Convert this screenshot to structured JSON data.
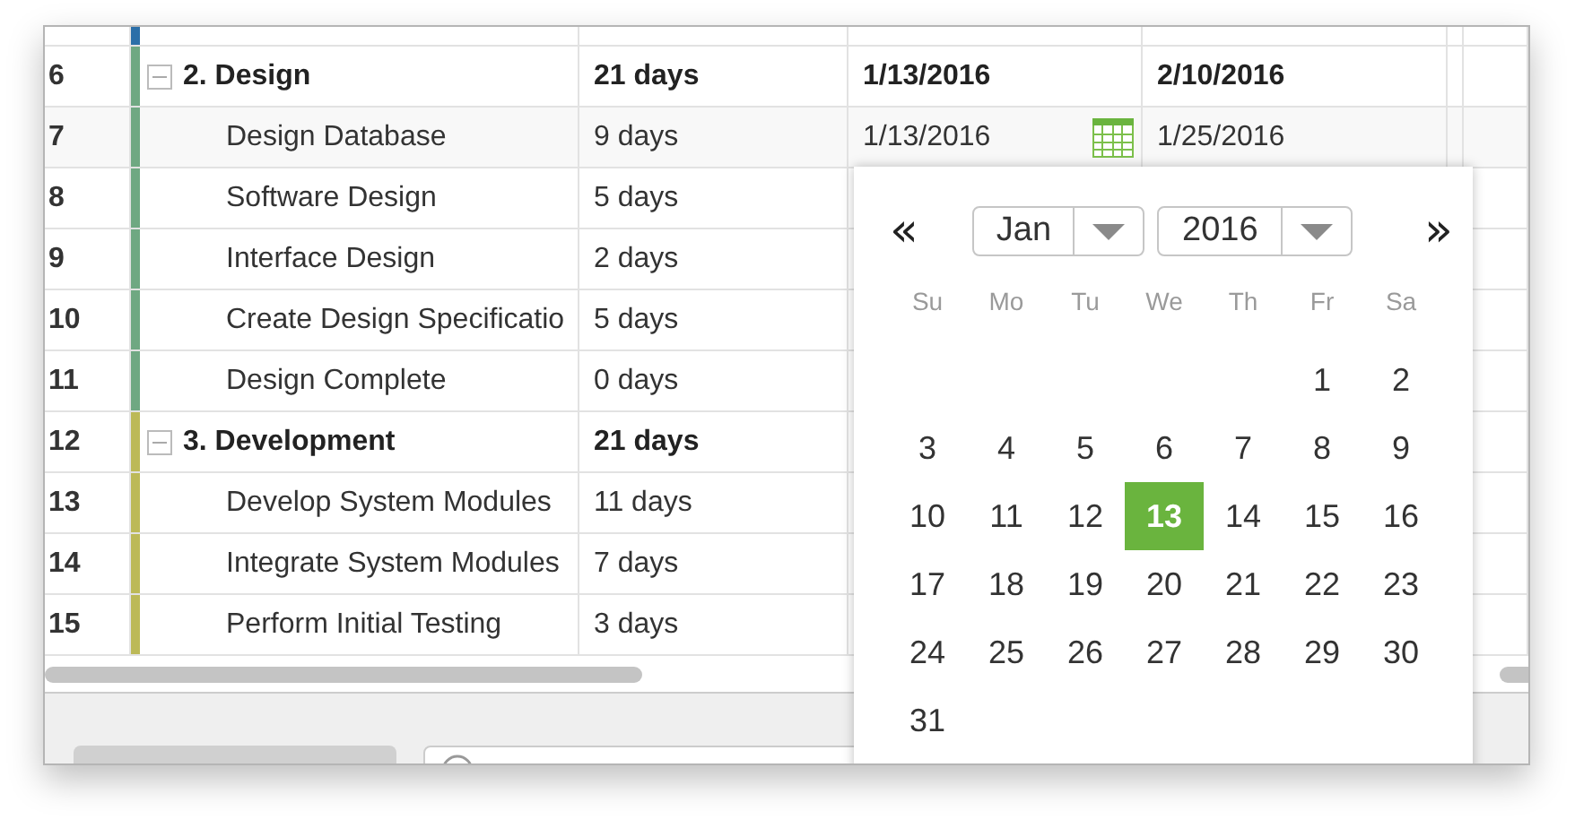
{
  "cut_row": {
    "color": "#2b6fa8"
  },
  "rows": [
    {
      "number": "6",
      "kind": "summary",
      "expanded": true,
      "name": "2. Design",
      "duration": "21 days",
      "start": "1/13/2016",
      "finish": "2/10/2016",
      "editing": false,
      "color": "#6fa882"
    },
    {
      "number": "7",
      "kind": "task",
      "name": "Design Database",
      "duration": "9 days",
      "start": "1/13/2016",
      "finish": "1/25/2016",
      "editing": true,
      "color": "#6fa882"
    },
    {
      "number": "8",
      "kind": "task",
      "name": "Software Design",
      "duration": "5 days",
      "color": "#6fa882"
    },
    {
      "number": "9",
      "kind": "task",
      "name": "Interface Design",
      "duration": "2 days",
      "color": "#6fa882"
    },
    {
      "number": "10",
      "kind": "task",
      "name": "Create Design Specificatio",
      "duration": "5 days",
      "color": "#6fa882"
    },
    {
      "number": "11",
      "kind": "task",
      "name": "Design Complete",
      "duration": "0 days",
      "color": "#6fa882"
    },
    {
      "number": "12",
      "kind": "summary",
      "expanded": true,
      "name": "3. Development",
      "duration": "21 days",
      "color": "#bcb957"
    },
    {
      "number": "13",
      "kind": "task",
      "name": "Develop System Modules",
      "duration": "11 days",
      "color": "#bcb957"
    },
    {
      "number": "14",
      "kind": "task",
      "name": "Integrate System Modules",
      "duration": "7 days",
      "color": "#bcb957"
    },
    {
      "number": "15",
      "kind": "task",
      "name": "Perform Initial Testing",
      "duration": "3 days",
      "color": "#bcb957"
    }
  ],
  "calendar": {
    "prev": "«",
    "next": "»",
    "month": "Jan",
    "year": "2016",
    "weekdays": [
      "Su",
      "Mo",
      "Tu",
      "We",
      "Th",
      "Fr",
      "Sa"
    ],
    "weeks": [
      {
        "days": [
          {
            "day": "1",
            "selected": false
          },
          {
            "day": "2",
            "selected": false
          }
        ]
      },
      {
        "days": [
          {
            "day": "3",
            "selected": false
          },
          {
            "day": "4",
            "selected": false
          },
          {
            "day": "5",
            "selected": false
          },
          {
            "day": "6",
            "selected": false
          },
          {
            "day": "7",
            "selected": false
          },
          {
            "day": "8",
            "selected": false
          },
          {
            "day": "9",
            "selected": false
          }
        ]
      },
      {
        "days": [
          {
            "day": "10",
            "selected": false
          },
          {
            "day": "11",
            "selected": false
          },
          {
            "day": "12",
            "selected": false
          },
          {
            "day": "13",
            "selected": true
          },
          {
            "day": "14",
            "selected": false
          },
          {
            "day": "15",
            "selected": false
          },
          {
            "day": "16",
            "selected": false
          }
        ]
      },
      {
        "days": [
          {
            "day": "17",
            "selected": false
          },
          {
            "day": "18",
            "selected": false
          },
          {
            "day": "19",
            "selected": false
          },
          {
            "day": "20",
            "selected": false
          },
          {
            "day": "21",
            "selected": false
          },
          {
            "day": "22",
            "selected": false
          },
          {
            "day": "23",
            "selected": false
          }
        ]
      },
      {
        "days": [
          {
            "day": "24",
            "selected": false
          },
          {
            "day": "25",
            "selected": false
          },
          {
            "day": "26",
            "selected": false
          },
          {
            "day": "27",
            "selected": false
          },
          {
            "day": "28",
            "selected": false
          },
          {
            "day": "29",
            "selected": false
          },
          {
            "day": "30",
            "selected": false
          }
        ]
      },
      {
        "days": [
          {
            "day": "31",
            "selected": false
          }
        ]
      }
    ]
  }
}
